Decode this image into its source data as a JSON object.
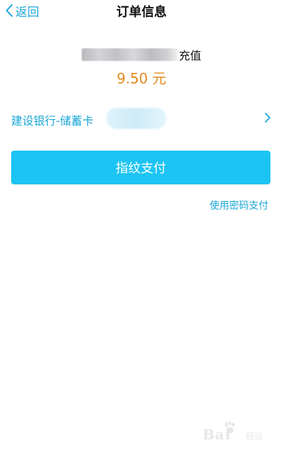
{
  "nav": {
    "back_label": "返回",
    "title": "订单信息"
  },
  "order": {
    "product_suffix": "充值",
    "amount": "9.50 元"
  },
  "payment": {
    "bank_name": "建设银行-储蓄卡"
  },
  "actions": {
    "fingerprint_pay_label": "指纹支付",
    "password_pay_label": "使用密码支付"
  },
  "watermark": {
    "brand": "Bai",
    "sub": "经验"
  },
  "colors": {
    "accent": "#1aa7d6",
    "button": "#1cc4f3",
    "amount": "#e38a1f",
    "title": "#111111"
  },
  "icons": {
    "back": "chevron-left-icon",
    "row_arrow": "chevron-right-icon"
  }
}
